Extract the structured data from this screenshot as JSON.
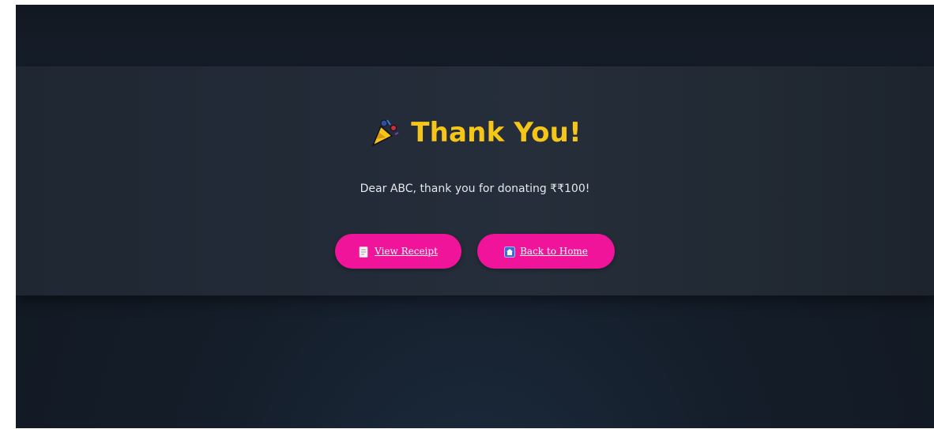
{
  "page": {
    "title_icon": "party-popper-icon",
    "title": "Thank You!",
    "message": "Dear ABC, thank you for donating ₹₹100!"
  },
  "actions": {
    "view_receipt": {
      "label": "View Receipt",
      "icon": "receipt-icon"
    },
    "back_home": {
      "label": "Back to Home",
      "icon": "home-icon"
    }
  },
  "colors": {
    "accent": "#f0149b",
    "title": "#f5c518",
    "background": "#141d29",
    "card": "#222b37"
  }
}
